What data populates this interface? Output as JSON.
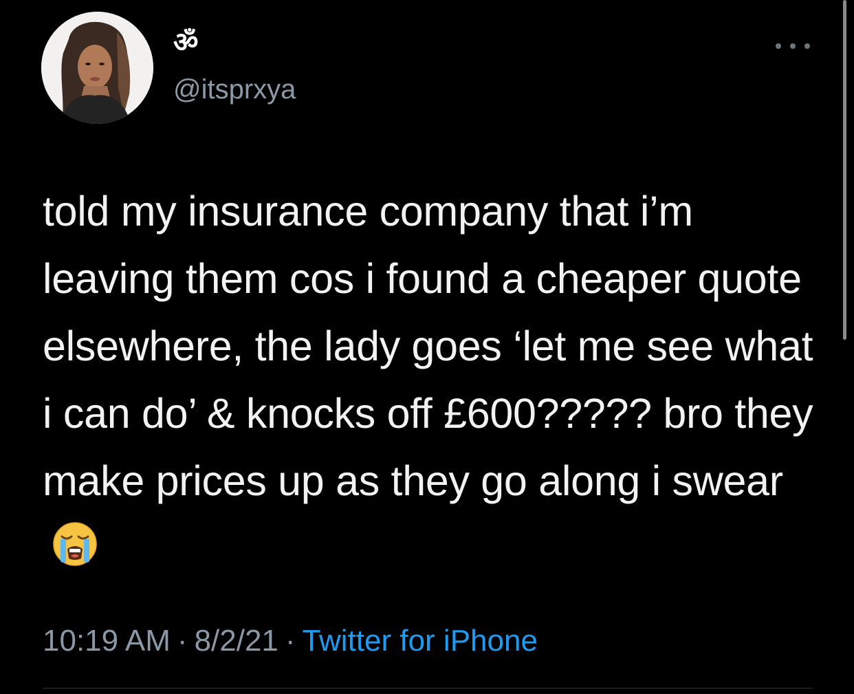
{
  "tweet": {
    "display_name": "ॐ",
    "handle": "@itsprxya",
    "text": "told my insurance company that i’m leaving them cos i found a cheaper quote elsewhere, the lady goes ‘let me see what i can do’ & knocks off £600????? bro they make prices up as they go along i swear",
    "emoji": "loudly-crying-face",
    "time": "10:19 AM",
    "date": "8/2/21",
    "separator": "·",
    "source": "Twitter for iPhone"
  },
  "icons": {
    "more": "more-options-icon"
  },
  "colors": {
    "background": "#000000",
    "text": "#f2f2f2",
    "secondary": "#8b98a5",
    "link": "#1d9bf0"
  }
}
